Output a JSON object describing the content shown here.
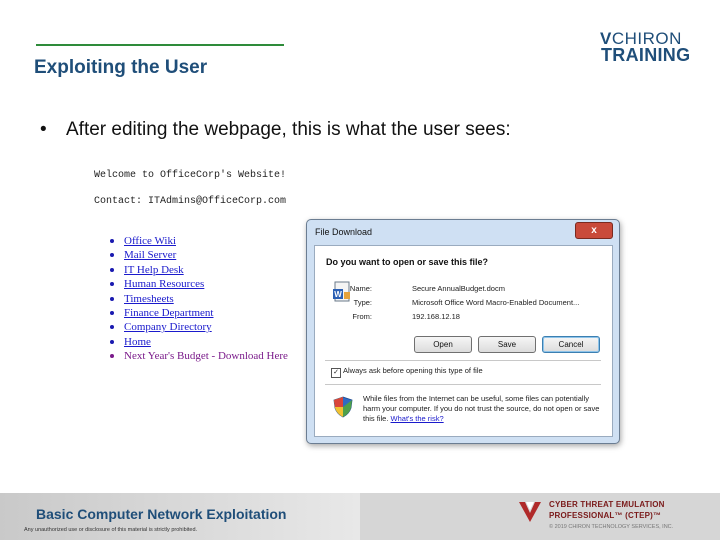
{
  "header": {
    "title": "Exploiting the User",
    "logo_line1_mark": "V",
    "logo_line1_text": "CHIRON",
    "logo_line2": "TRAINING"
  },
  "content": {
    "bullet": "•",
    "bullet_text": "After editing the webpage, this is what the user sees:"
  },
  "webpage": {
    "welcome": "Welcome to OfficeCorp's Website!",
    "contact": "Contact: ITAdmins@OfficeCorp.com",
    "links": [
      {
        "label": "Office Wiki",
        "visited": false
      },
      {
        "label": "Mail Server",
        "visited": false
      },
      {
        "label": "IT Help Desk",
        "visited": false
      },
      {
        "label": "Human Resources",
        "visited": false
      },
      {
        "label": "Timesheets",
        "visited": false
      },
      {
        "label": "Finance Department",
        "visited": false
      },
      {
        "label": "Company Directory",
        "visited": false
      },
      {
        "label": "Home",
        "visited": false
      },
      {
        "label": "Next Year's Budget - Download Here",
        "visited": true
      }
    ]
  },
  "dialog": {
    "title": "File Download",
    "close_glyph": "x",
    "question": "Do you want to open or save this file?",
    "fields": [
      {
        "label": "Name:",
        "value": "Secure AnnualBudget.docm"
      },
      {
        "label": "Type:",
        "value": "Microsoft Office Word Macro-Enabled Document..."
      },
      {
        "label": "From:",
        "value": "192.168.12.18"
      }
    ],
    "buttons": {
      "open": "Open",
      "save": "Save",
      "cancel": "Cancel"
    },
    "checkbox_mark": "✓",
    "checkbox_label": "Always ask before opening this type of file",
    "warning_text": "While files from the Internet can be useful, some files can potentially harm your computer. If you do not trust the source, do not open or save this file.",
    "warning_link": "What's the risk?"
  },
  "footer": {
    "course": "Basic Computer Network Exploitation",
    "disclaimer": "Any unauthorized use or disclosure of this material is strictly prohibited.",
    "program_line1": "CYBER THREAT EMULATION",
    "program_line2": "PROFESSIONAL™ (CTEP)™",
    "copyright": "© 2019 CHIRON TECHNOLOGY SERVICES, INC."
  },
  "colors": {
    "title": "#1f4e79",
    "accent_rule": "#2e8b3a",
    "link": "#1a1acc",
    "visited_link": "#7a1a8a",
    "program": "#7a1a1a"
  },
  "icons": {
    "file": "word-document-icon",
    "shield": "security-shield-icon",
    "emblem": "ctep-emblem-icon"
  }
}
